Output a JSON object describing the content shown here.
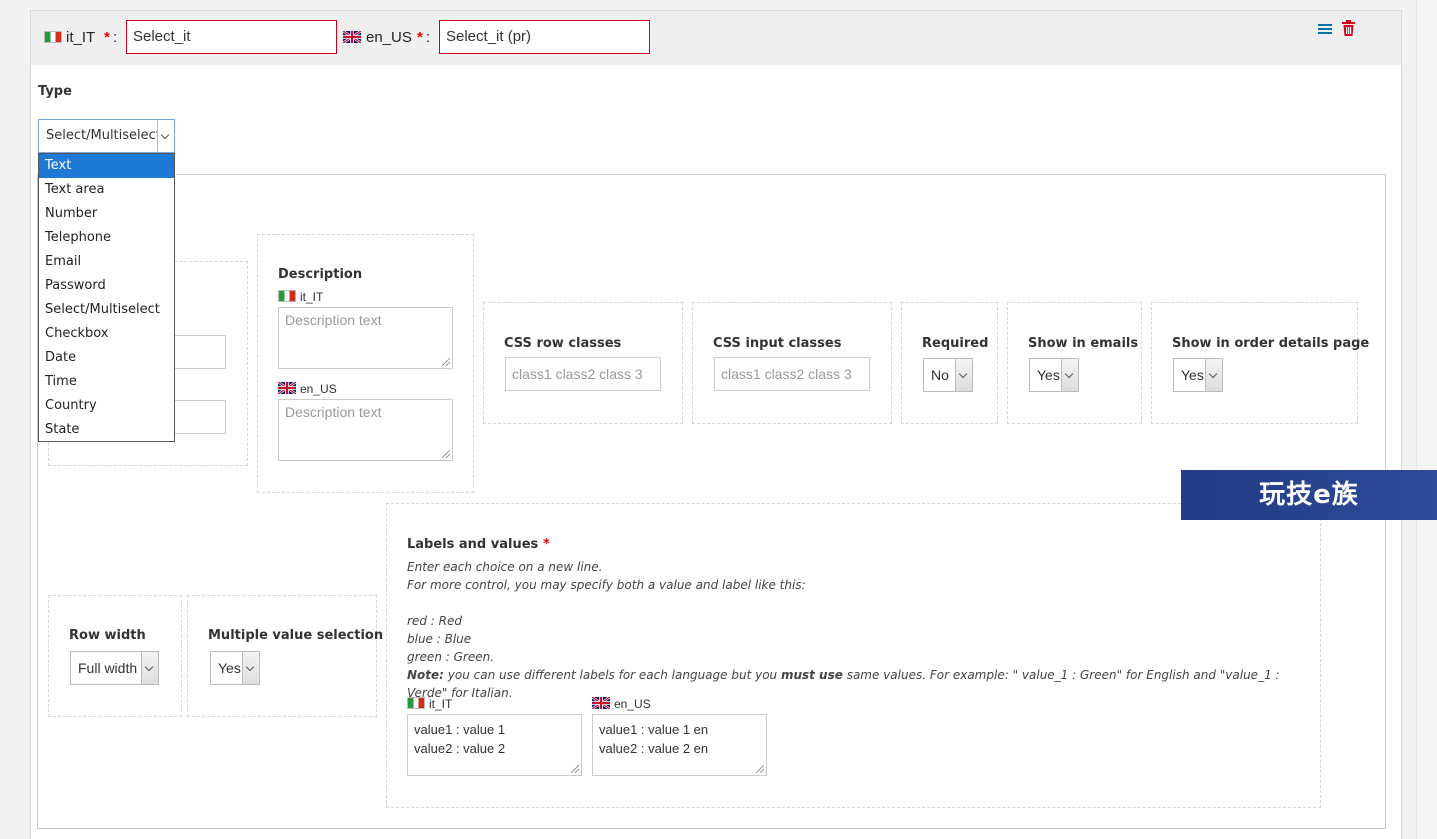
{
  "header": {
    "lang1": "it_IT",
    "lang2": "en_US",
    "required_mark": "*",
    "colon": ":",
    "name_it": "Select_it",
    "name_en": "Select_it (pr)"
  },
  "type_field": {
    "label": "Type",
    "selected": "Select/Multiselect",
    "options": [
      "Text",
      "Text area",
      "Number",
      "Telephone",
      "Email",
      "Password",
      "Select/Multiselect",
      "Checkbox",
      "Date",
      "Time",
      "Country",
      "State"
    ],
    "highlighted": "Text"
  },
  "description": {
    "label": "Description",
    "lang1": "it_IT",
    "lang2": "en_US",
    "placeholder": "Description text"
  },
  "css_row": {
    "label": "CSS row classes",
    "placeholder": "class1 class2 class 3"
  },
  "css_input": {
    "label": "CSS input classes",
    "placeholder": "class1 class2 class 3"
  },
  "required": {
    "label": "Required",
    "value": "No"
  },
  "show_emails": {
    "label": "Show in emails",
    "value": "Yes"
  },
  "show_order": {
    "label": "Show in order details page",
    "value": "Yes"
  },
  "row_width": {
    "label": "Row width",
    "value": "Full width"
  },
  "multiple": {
    "label": "Multiple value selection",
    "value": "Yes"
  },
  "labels_values": {
    "label": "Labels and values",
    "required_mark": "*",
    "help": [
      "Enter each choice on a new line.",
      "For more control, you may specify both a value and label like this:",
      "",
      "red : Red",
      "blue : Blue",
      "green : Green."
    ],
    "note_prefix": "Note:",
    "note_text_1": " you can use different labels for each language but you ",
    "note_bold": "must use",
    "note_text_2": " same values. For example: \" value_1 : Green\" for English and \"value_1 : Verde\" for Italian.",
    "lang1": "it_IT",
    "lang2": "en_US",
    "values_it": "value1 : value 1\nvalue2 : value 2",
    "values_en": "value1 : value 1 en\nvalue2 : value 2 en"
  },
  "watermark": "玩技e族",
  "colors": {
    "accent": "#1e78d6",
    "error_border": "#d0021b",
    "delete_icon": "#d0021b",
    "menu_icon": "#0073aa"
  },
  "icons": [
    "menu-icon",
    "trash-icon",
    "italy-flag-icon",
    "uk-flag-icon",
    "chevron-down-icon",
    "resize-grip-icon"
  ]
}
